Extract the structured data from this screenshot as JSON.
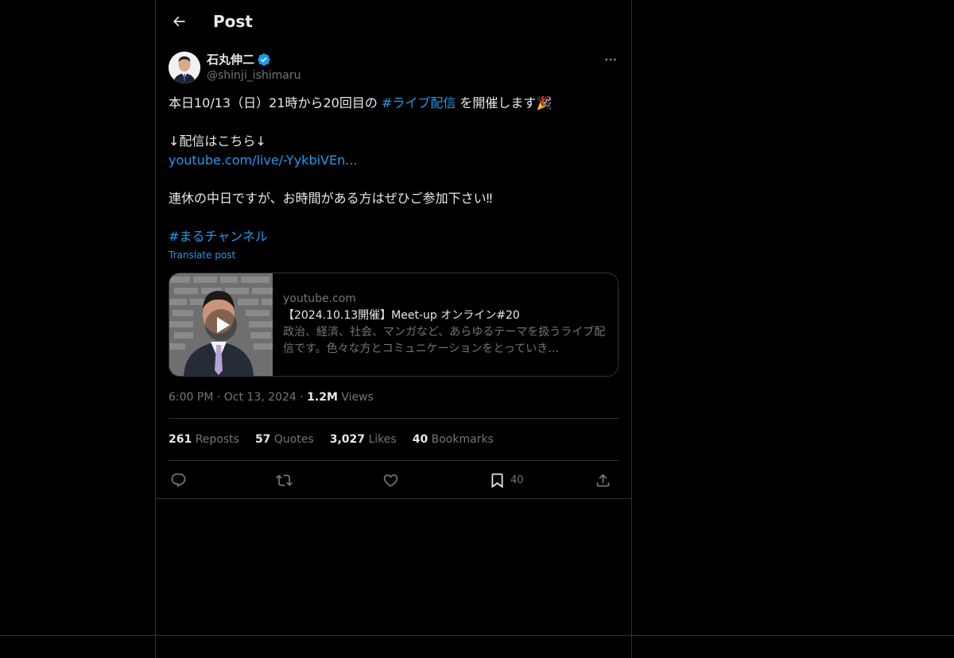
{
  "header": {
    "title": "Post"
  },
  "author": {
    "name": "石丸伸二",
    "handle": "@shinji_ishimaru",
    "verified": true
  },
  "post": {
    "line1_before": "本日10/13（日）21時から20回目の ",
    "line1_hashtag": "#ライブ配信",
    "line1_after": " を開催します",
    "line1_emoji": "🎉",
    "line2": "↓配信はこちら↓",
    "line3_link": "youtube.com/live/-YykbiVEn...",
    "line4": "連休の中日ですが、お時間がある方はぜひご参加下さい‼",
    "line5_hashtag": "#まるチャンネル",
    "translate_label": "Translate post"
  },
  "card": {
    "domain": "youtube.com",
    "title": "【2024.10.13開催】Meet-up オンライン#20",
    "description": "政治、経済、社会、マンガなど、あらゆるテーマを扱うライブ配信です。色々な方とコミュニケーションをとっていき…"
  },
  "meta": {
    "time": "6:00 PM",
    "sep1": " · ",
    "date": "Oct 13, 2024",
    "sep2": " · ",
    "views_count": "1.2M",
    "views_label": " Views"
  },
  "stats": {
    "reposts_count": "261",
    "reposts_label": "Reposts",
    "quotes_count": "57",
    "quotes_label": "Quotes",
    "likes_count": "3,027",
    "likes_label": "Likes",
    "bookmarks_count": "40",
    "bookmarks_label": "Bookmarks"
  },
  "actions": {
    "bookmark_count": "40"
  },
  "icons": {
    "back": "arrow-left-icon",
    "verified": "verified-badge-icon",
    "more": "more-horizontal-icon",
    "reply": "reply-icon",
    "repost": "repost-icon",
    "like": "heart-icon",
    "bookmark": "bookmark-icon",
    "share": "share-icon",
    "play": "play-icon"
  },
  "colors": {
    "accent": "#1d9bf0",
    "background": "#000000",
    "text": "#e7e9ea",
    "secondary": "#71767b",
    "border": "#2f3336"
  }
}
